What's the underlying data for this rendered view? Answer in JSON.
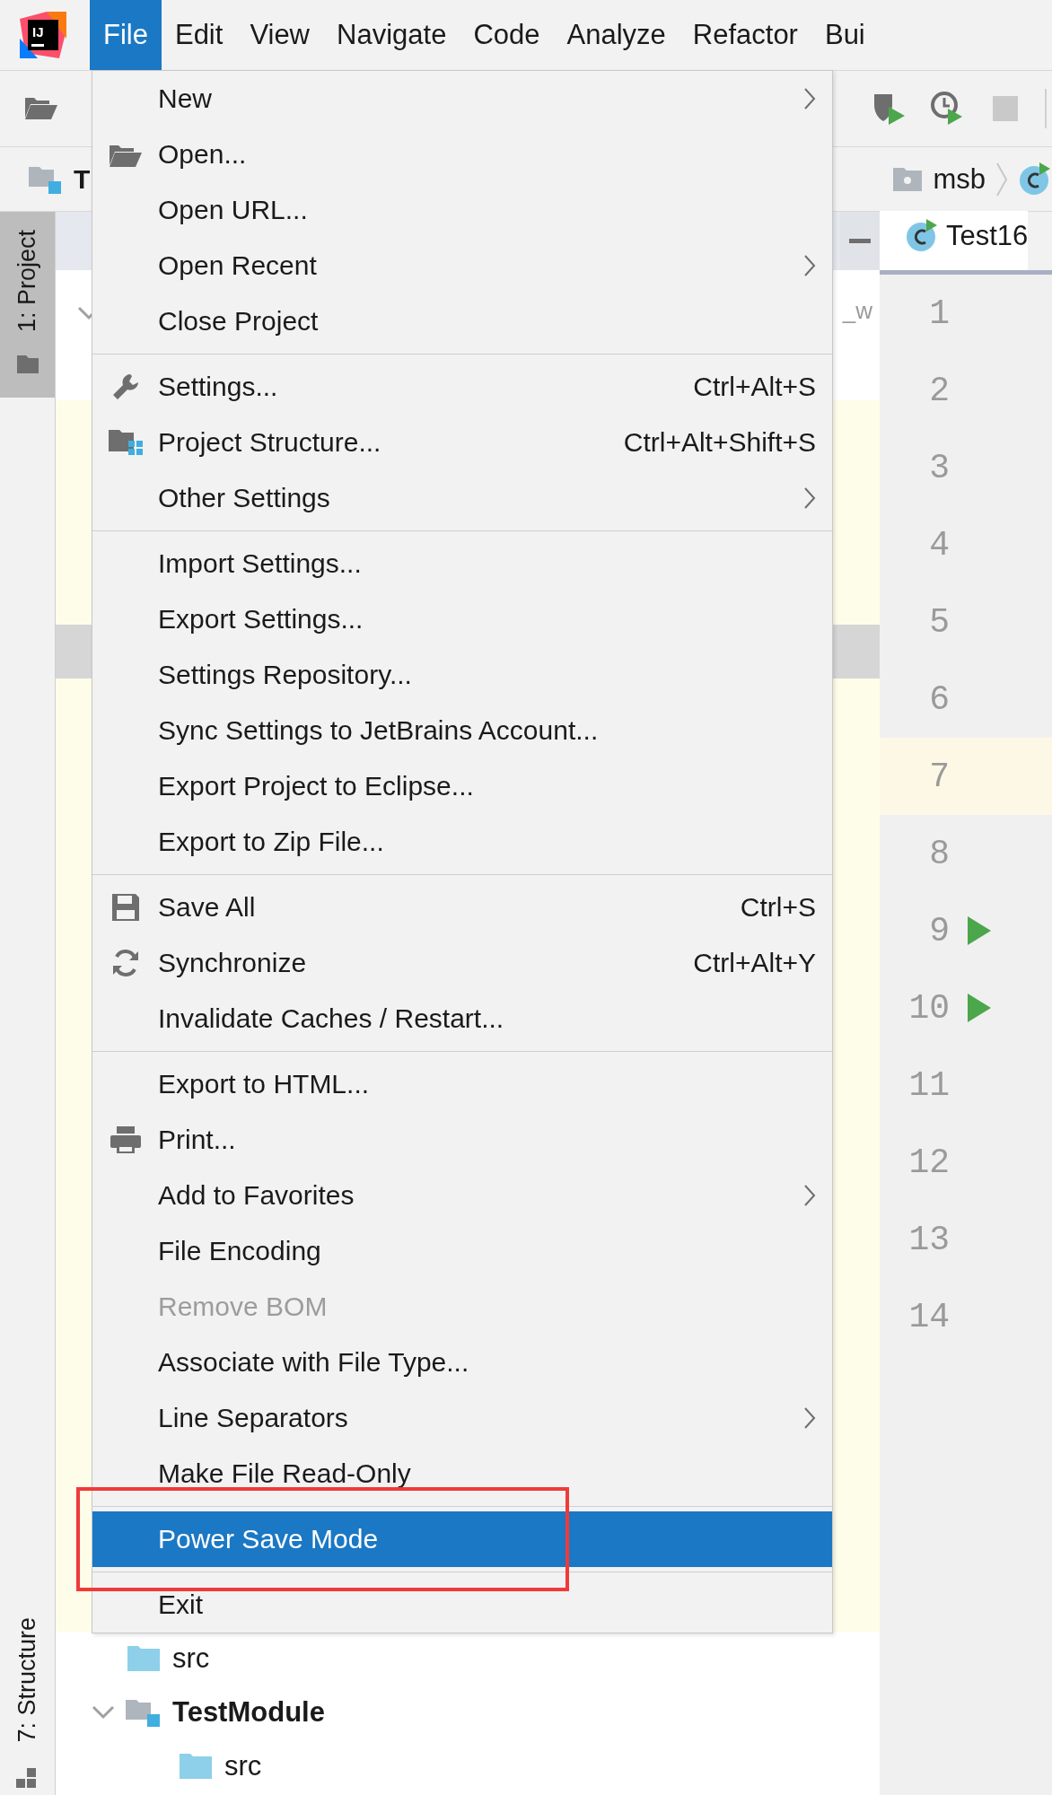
{
  "app_logo": {
    "text": "IJ"
  },
  "menu_bar": [
    {
      "label": "File",
      "selected": true
    },
    {
      "label": "Edit",
      "selected": false
    },
    {
      "label": "View",
      "selected": false
    },
    {
      "label": "Navigate",
      "selected": false
    },
    {
      "label": "Code",
      "selected": false
    },
    {
      "label": "Analyze",
      "selected": false
    },
    {
      "label": "Refactor",
      "selected": false
    },
    {
      "label": "Bui",
      "selected": false
    }
  ],
  "breadcrumbs": {
    "project": "T",
    "folder": "msb"
  },
  "project_panel": {
    "header_text": "_w",
    "tree": [
      {
        "label": "src",
        "kind": "folder"
      },
      {
        "label": "TestModule",
        "kind": "module",
        "expanded": true,
        "children": [
          {
            "label": "src",
            "kind": "folder"
          }
        ]
      }
    ]
  },
  "editor": {
    "tab": "Test16",
    "lines": [
      {
        "number": "1",
        "current": false,
        "run_marker": false
      },
      {
        "number": "2",
        "current": false,
        "run_marker": false
      },
      {
        "number": "3",
        "current": false,
        "run_marker": false
      },
      {
        "number": "4",
        "current": false,
        "run_marker": false
      },
      {
        "number": "5",
        "current": false,
        "run_marker": false
      },
      {
        "number": "6",
        "current": false,
        "run_marker": false
      },
      {
        "number": "7",
        "current": true,
        "run_marker": false
      },
      {
        "number": "8",
        "current": false,
        "run_marker": false
      },
      {
        "number": "9",
        "current": false,
        "run_marker": true
      },
      {
        "number": "10",
        "current": false,
        "run_marker": true
      },
      {
        "number": "11",
        "current": false,
        "run_marker": false
      },
      {
        "number": "12",
        "current": false,
        "run_marker": false
      },
      {
        "number": "13",
        "current": false,
        "run_marker": false
      },
      {
        "number": "14",
        "current": false,
        "run_marker": false
      }
    ]
  },
  "tool_stripe": {
    "top_tab": "1: Project",
    "bottom_tab": "7: Structure"
  },
  "file_menu": {
    "sections": [
      {
        "items": [
          {
            "label": "New",
            "submenu": true,
            "disabled": false,
            "selected": false
          },
          {
            "label": "Open...",
            "submenu": false,
            "disabled": false,
            "selected": false
          },
          {
            "label": "Open URL...",
            "submenu": false,
            "disabled": false,
            "selected": false
          },
          {
            "label": "Open Recent",
            "submenu": true,
            "disabled": false,
            "selected": false
          },
          {
            "label": "Close Project",
            "submenu": false,
            "disabled": false,
            "selected": false
          }
        ]
      },
      {
        "items": [
          {
            "label": "Settings...",
            "shortcut": "Ctrl+Alt+S",
            "submenu": false,
            "disabled": false,
            "selected": false
          },
          {
            "label": "Project Structure...",
            "shortcut": "Ctrl+Alt+Shift+S",
            "submenu": false,
            "disabled": false,
            "selected": false
          },
          {
            "label": "Other Settings",
            "submenu": true,
            "disabled": false,
            "selected": false
          }
        ]
      },
      {
        "items": [
          {
            "label": "Import Settings...",
            "submenu": false,
            "disabled": false,
            "selected": false
          },
          {
            "label": "Export Settings...",
            "submenu": false,
            "disabled": false,
            "selected": false
          },
          {
            "label": "Settings Repository...",
            "submenu": false,
            "disabled": false,
            "selected": false
          },
          {
            "label": "Sync Settings to JetBrains Account...",
            "submenu": false,
            "disabled": false,
            "selected": false
          },
          {
            "label": "Export Project to Eclipse...",
            "submenu": false,
            "disabled": false,
            "selected": false
          },
          {
            "label": "Export to Zip File...",
            "submenu": false,
            "disabled": false,
            "selected": false
          }
        ]
      },
      {
        "items": [
          {
            "label": "Save All",
            "shortcut": "Ctrl+S",
            "submenu": false,
            "disabled": false,
            "selected": false
          },
          {
            "label": "Synchronize",
            "shortcut": "Ctrl+Alt+Y",
            "submenu": false,
            "disabled": false,
            "selected": false
          },
          {
            "label": "Invalidate Caches / Restart...",
            "submenu": false,
            "disabled": false,
            "selected": false
          }
        ]
      },
      {
        "items": [
          {
            "label": "Export to HTML...",
            "submenu": false,
            "disabled": false,
            "selected": false
          },
          {
            "label": "Print...",
            "submenu": false,
            "disabled": false,
            "selected": false
          },
          {
            "label": "Add to Favorites",
            "submenu": true,
            "disabled": false,
            "selected": false
          },
          {
            "label": "File Encoding",
            "submenu": false,
            "disabled": false,
            "selected": false
          },
          {
            "label": "Remove BOM",
            "submenu": false,
            "disabled": true,
            "selected": false
          },
          {
            "label": "Associate with File Type...",
            "submenu": false,
            "disabled": false,
            "selected": false
          },
          {
            "label": "Line Separators",
            "submenu": true,
            "disabled": false,
            "selected": false
          },
          {
            "label": "Make File Read-Only",
            "submenu": false,
            "disabled": false,
            "selected": false
          }
        ]
      },
      {
        "items": [
          {
            "label": "Power Save Mode",
            "submenu": false,
            "disabled": false,
            "selected": true
          }
        ]
      },
      {
        "items": [
          {
            "label": "Exit",
            "submenu": false,
            "disabled": false,
            "selected": false
          }
        ]
      }
    ]
  }
}
